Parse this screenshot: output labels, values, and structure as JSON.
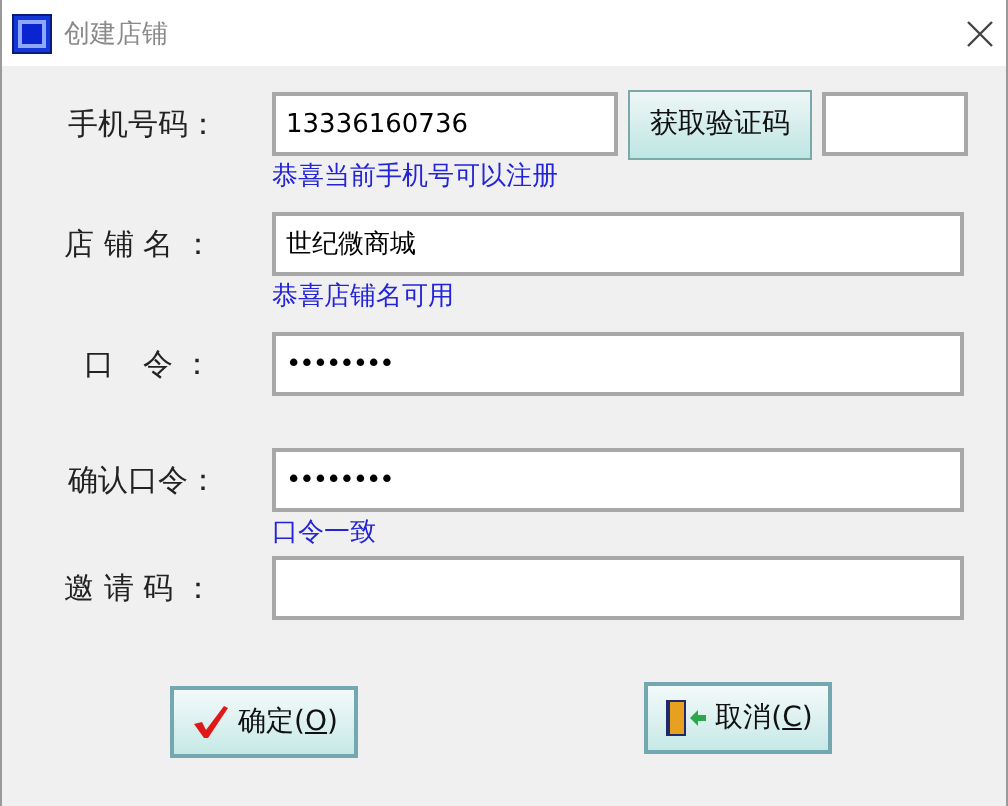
{
  "window": {
    "title": "创建店铺"
  },
  "form": [
    {
      "label": "手机号码：",
      "kind": "phone",
      "value": "13336160736",
      "button": "获取验证码",
      "hint": "恭喜当前手机号可以注册"
    },
    {
      "label": "店 铺 名 ：",
      "kind": "text",
      "value": "世纪微商城",
      "hint": "恭喜店铺名可用"
    },
    {
      "label": "口   令 ：",
      "kind": "password",
      "value": "••••••••"
    },
    {
      "label": "确认口令：",
      "kind": "password",
      "value": "••••••••",
      "hint": "口令一致"
    },
    {
      "label": "邀 请 码 ：",
      "kind": "text"
    }
  ],
  "buttons": [
    {
      "kind": "ok",
      "label": "确定(",
      "mnemonic": "O",
      "suffix": ")"
    },
    {
      "kind": "cancel",
      "label": "取消(",
      "mnemonic": "C",
      "suffix": ")"
    }
  ]
}
